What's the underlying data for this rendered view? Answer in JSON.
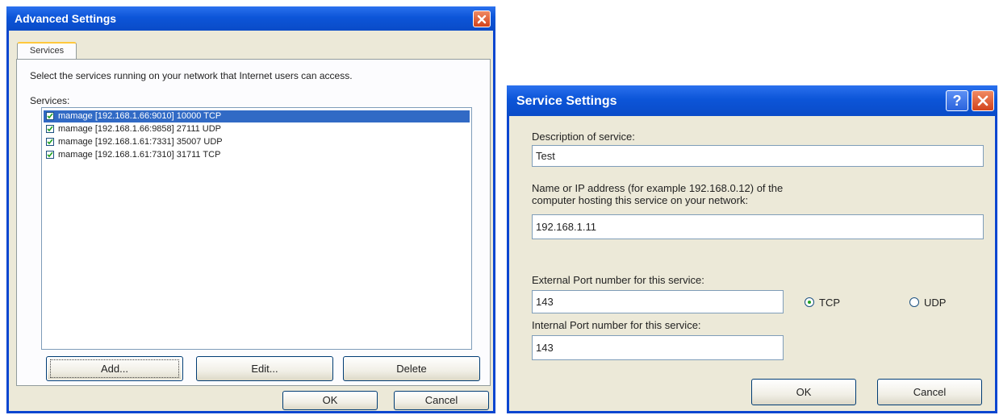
{
  "advanced": {
    "title": "Advanced Settings",
    "tab": "Services",
    "instruction": "Select the services running on your network that Internet users can access.",
    "services_label": "Services:",
    "services": [
      {
        "text": "mamage [192.168.1.66:9010] 10000 TCP",
        "checked": true,
        "selected": true
      },
      {
        "text": "mamage [192.168.1.66:9858] 27111 UDP",
        "checked": true,
        "selected": false
      },
      {
        "text": "mamage [192.168.1.61:7331] 35007 UDP",
        "checked": true,
        "selected": false
      },
      {
        "text": "mamage [192.168.1.61:7310] 31711 TCP",
        "checked": true,
        "selected": false
      }
    ],
    "add_label": "Add...",
    "edit_label": "Edit...",
    "delete_label": "Delete",
    "ok_label": "OK",
    "cancel_label": "Cancel"
  },
  "service": {
    "title": "Service Settings",
    "description_label": "Description of service:",
    "description_value": "Test",
    "host_label_line1": "Name or IP address (for example 192.168.0.12) of the",
    "host_label_line2": "computer hosting this service on your network:",
    "host_value": "192.168.1.11",
    "external_label": "External Port number for this service:",
    "external_value": "143",
    "internal_label": "Internal Port number for this service:",
    "internal_value": "143",
    "protocol_tcp": "TCP",
    "protocol_udp": "UDP",
    "protocol_selected": "TCP",
    "ok_label": "OK",
    "cancel_label": "Cancel"
  },
  "colors": {
    "titlebar": "#0c55d8",
    "dialog_bg": "#ece9d8",
    "selection": "#316ac5",
    "close_button": "#d2431c"
  }
}
